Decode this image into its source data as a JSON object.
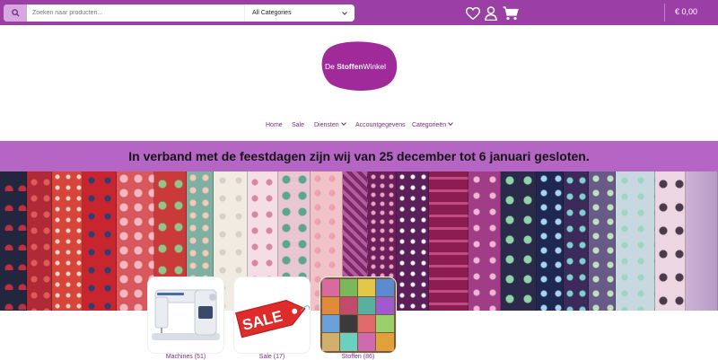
{
  "header": {
    "search": {
      "placeholder": "Zoeken naar producten..."
    },
    "category_select": {
      "selected": "All Categories"
    },
    "cart_total": "€ 0,00"
  },
  "logo": {
    "text_part1": "De ",
    "text_part2": "Stoffen",
    "text_part3": "Winkel"
  },
  "nav": {
    "items": [
      {
        "label": "Home"
      },
      {
        "label": "Sale"
      },
      {
        "label": "Diensten"
      },
      {
        "label": "Accountgegevens"
      },
      {
        "label": "Categorieën"
      }
    ]
  },
  "banner": {
    "text": "In verband met de feestdagen zijn wij van 25 december tot 6 januari gesloten."
  },
  "categories": [
    {
      "label": "Machines (51)"
    },
    {
      "label": "Sale (17)"
    },
    {
      "label": "Stoffen (86)"
    }
  ],
  "sale_tag": {
    "text": "SALE"
  },
  "colors": {
    "brand": "#9b3fa6",
    "banner": "#b565c4",
    "link": "#7a2b86"
  }
}
